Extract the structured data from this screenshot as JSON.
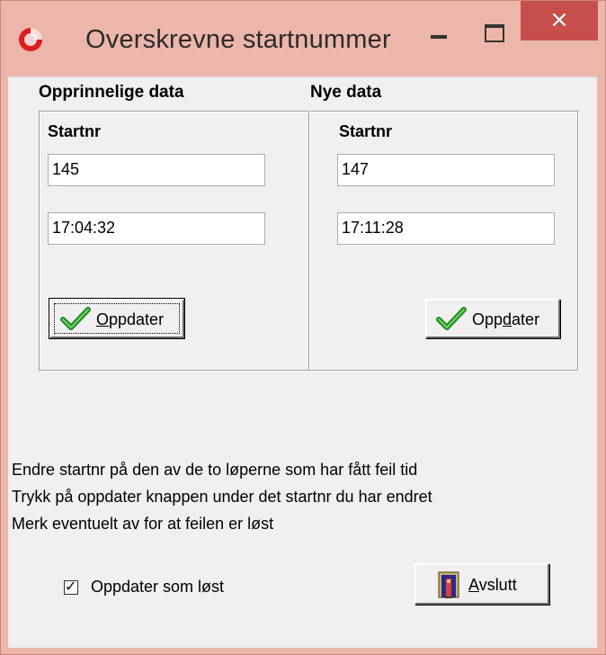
{
  "window": {
    "title": "Overskrevne startnummer",
    "close_glyph": "×",
    "app_icon": "red-circle-app-icon",
    "colors": {
      "frame": "#ecb6aa",
      "close": "#c74f4b",
      "client": "#f0f0f0"
    }
  },
  "original": {
    "heading": "Opprinnelige data",
    "startnr_label": "Startnr",
    "startnr_value": "145",
    "time_value": "17:04:32",
    "update_button": {
      "mnemonic": "O",
      "rest": "ppdater",
      "icon": "check-icon"
    }
  },
  "new": {
    "heading": "Nye data",
    "startnr_label": "Startnr",
    "startnr_value": "147",
    "time_value": "17:11:28",
    "update_button": {
      "pre": "Opp",
      "mnemonic": "d",
      "rest": "ater",
      "icon": "check-icon"
    }
  },
  "instructions": [
    "Endre startnr på  den av de to løperne som har fått feil tid",
    "Trykk på oppdater knappen under det startnr du har endret",
    "Merk eventuelt av for at feilen er løst"
  ],
  "resolved_checkbox": {
    "label": "Oppdater som løst",
    "checked": true
  },
  "exit_button": {
    "mnemonic": "A",
    "rest": "vslutt",
    "icon": "exit-door-icon"
  }
}
